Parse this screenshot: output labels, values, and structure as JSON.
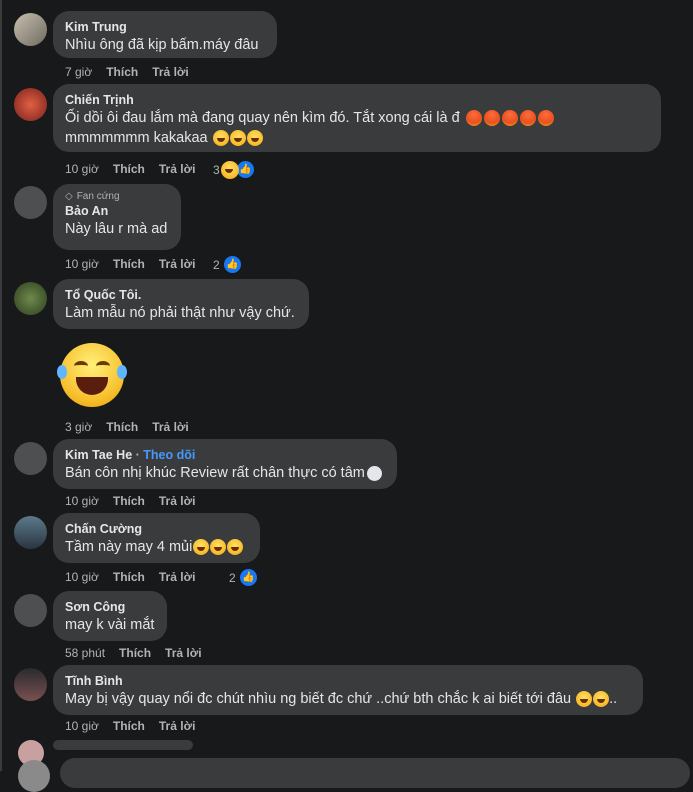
{
  "actions": {
    "like": "Thích",
    "reply": "Trả lời"
  },
  "comments": [
    {
      "author": "Kim Trung",
      "text": "Nhìu ông đã kịp bấm.máy đâu",
      "time": "7 giờ"
    },
    {
      "author": "Chiến Trịnh",
      "text_line1": "Ối dồi ôi đau lắm mà đang quay nên kìm đó. Tắt xong cái là đ",
      "text_line2": "mmmmmmm kakakaa",
      "time": "10 giờ",
      "reactions": "3"
    },
    {
      "badge": "Fan cứng",
      "author": "Bảo An",
      "text": "Này lâu r mà ad",
      "time": "10 giờ",
      "reactions": "2"
    },
    {
      "author": "Tổ Quốc Tôi.",
      "text": "Làm mẫu nó phải thật như vậy chứ.",
      "time": "3 giờ"
    },
    {
      "author": "Kim Tae He",
      "follow": "Theo dõi",
      "text": "Bán côn nhị khúc Review rất chân thực có tâm",
      "time": "10 giờ"
    },
    {
      "author": "Chấn Cường",
      "text": "Tầm này may 4 mủi",
      "time": "10 giờ",
      "reactions": "2"
    },
    {
      "author": "Sơn Công",
      "text": "may k vài mắt",
      "time": "58 phút"
    },
    {
      "author": "Tĩnh Bình",
      "text": "May bị vậy quay nổi đc chút nhìu ng biết đc chứ ..chứ bth chắc k ai biết tới đâu",
      "time": "10 giờ"
    }
  ],
  "icons": {
    "like": "like-thumb-icon",
    "haha": "haha-emoji-icon",
    "angry": "angry-emoji-icon",
    "fan": "diamond-icon"
  }
}
